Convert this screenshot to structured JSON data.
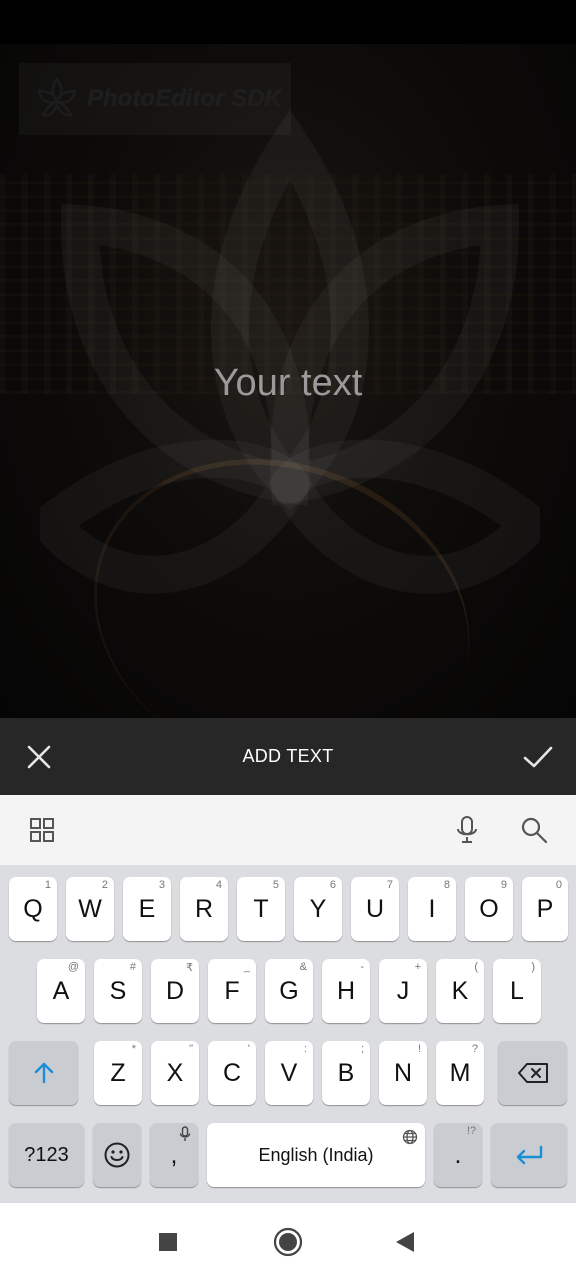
{
  "watermark": {
    "brand": "PhotoEditor SDK"
  },
  "canvas": {
    "text": "Your text"
  },
  "toolbar": {
    "title": "ADD TEXT",
    "cancel_icon": "close-icon",
    "confirm_icon": "check-icon"
  },
  "keyboard_toolbar": {
    "grid_icon": "grid-icon",
    "mic_icon": "microphone-icon",
    "search_icon": "search-icon"
  },
  "keyboard": {
    "row1": [
      {
        "key": "Q",
        "hint": "1"
      },
      {
        "key": "W",
        "hint": "2"
      },
      {
        "key": "E",
        "hint": "3"
      },
      {
        "key": "R",
        "hint": "4"
      },
      {
        "key": "T",
        "hint": "5"
      },
      {
        "key": "Y",
        "hint": "6"
      },
      {
        "key": "U",
        "hint": "7"
      },
      {
        "key": "I",
        "hint": "8"
      },
      {
        "key": "O",
        "hint": "9"
      },
      {
        "key": "P",
        "hint": "0"
      }
    ],
    "row2": [
      {
        "key": "A",
        "hint": "@"
      },
      {
        "key": "S",
        "hint": "#"
      },
      {
        "key": "D",
        "hint": "₹"
      },
      {
        "key": "F",
        "hint": "_"
      },
      {
        "key": "G",
        "hint": "&"
      },
      {
        "key": "H",
        "hint": "-"
      },
      {
        "key": "J",
        "hint": "+"
      },
      {
        "key": "K",
        "hint": "("
      },
      {
        "key": "L",
        "hint": ")"
      }
    ],
    "row3": [
      {
        "key": "Z",
        "hint": "*"
      },
      {
        "key": "X",
        "hint": "\""
      },
      {
        "key": "C",
        "hint": "'"
      },
      {
        "key": "V",
        "hint": ":"
      },
      {
        "key": "B",
        "hint": ";"
      },
      {
        "key": "N",
        "hint": "!"
      },
      {
        "key": "M",
        "hint": "?"
      }
    ],
    "symbols_label": "?123",
    "comma_label": ",",
    "space_label": "English (India)",
    "period_label": ".",
    "period_hint": "!?",
    "accent_color": "#1a8fd6"
  },
  "navigation": {
    "recents_icon": "square-icon",
    "home_icon": "circle-icon",
    "back_icon": "triangle-back-icon"
  }
}
